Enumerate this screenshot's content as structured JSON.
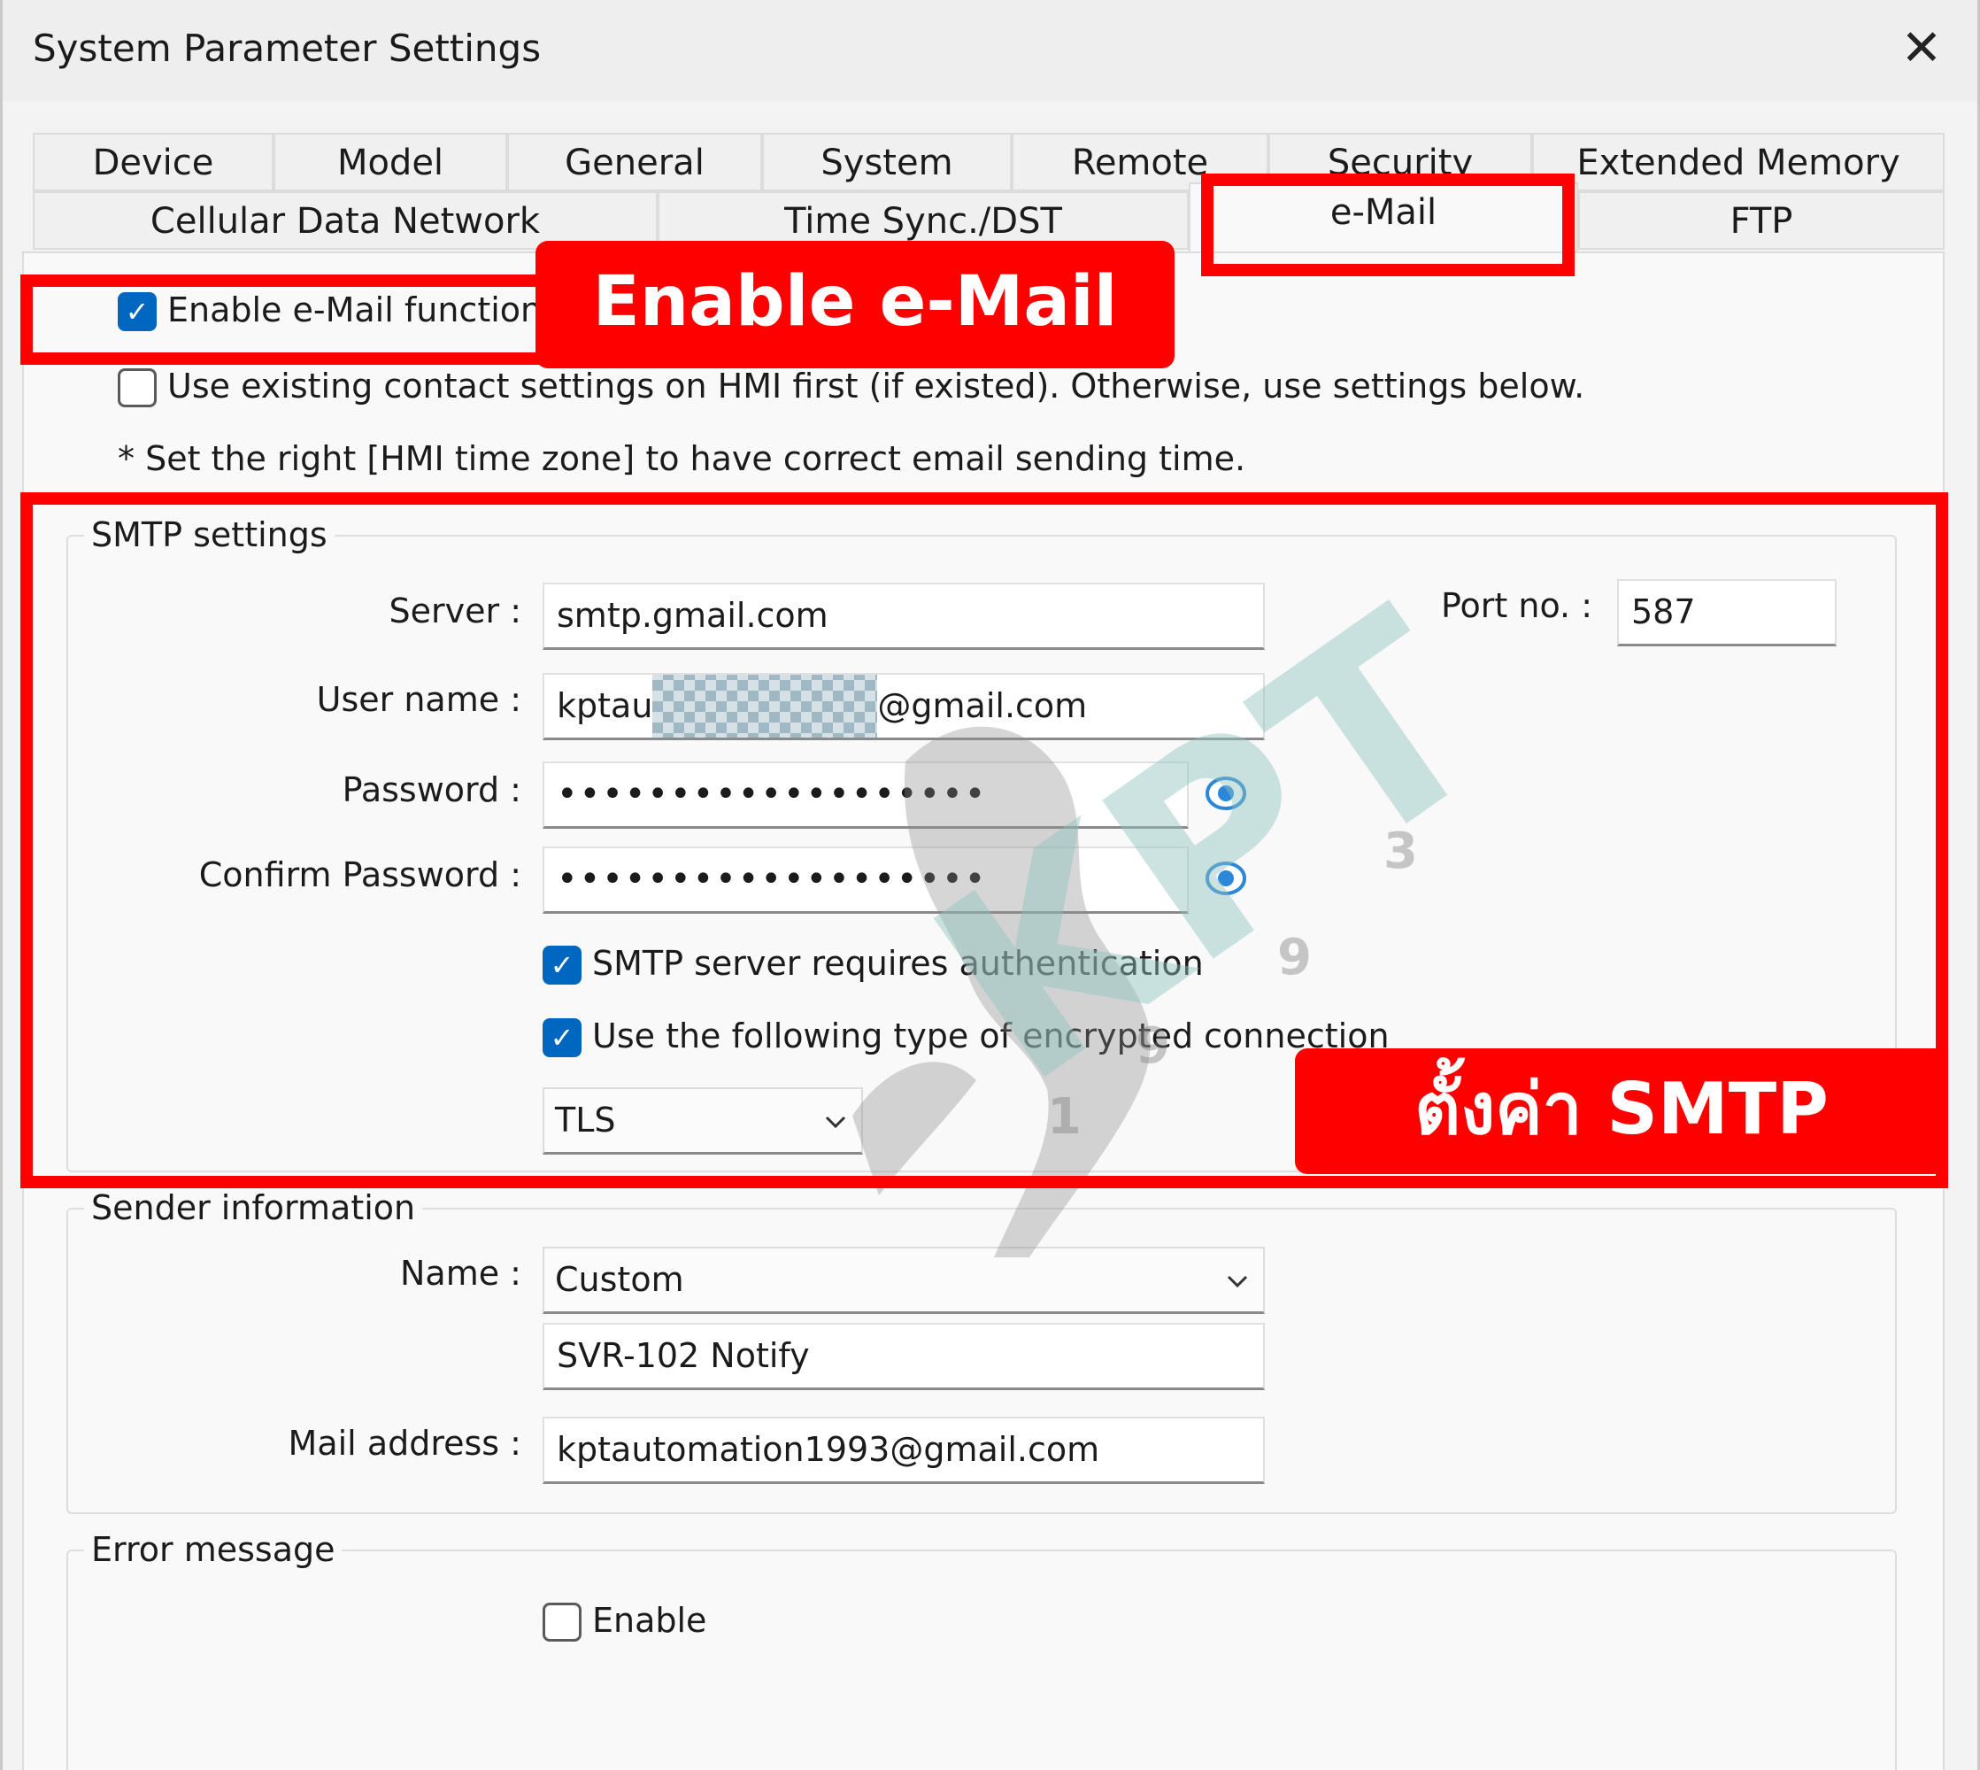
{
  "window": {
    "title": "System Parameter Settings"
  },
  "tabs": {
    "row1": [
      "Device",
      "Model",
      "General",
      "System",
      "Remote",
      "Security",
      "Extended Memory"
    ],
    "row2": [
      "Cellular Data Network",
      "Time Sync./DST",
      "e-Mail",
      "FTP"
    ],
    "active": "e-Mail"
  },
  "email": {
    "enable_label": "Enable e-Mail function",
    "enable_checked": true,
    "use_existing_label": "Use existing contact settings on HMI first (if existed). Otherwise, use settings below.",
    "use_existing_checked": false,
    "timezone_note": "* Set the right [HMI time zone] to have correct email sending time."
  },
  "smtp": {
    "group_label": "SMTP settings",
    "server_label": "Server :",
    "server_value": "smtp.gmail.com",
    "port_label": "Port no. :",
    "port_value": "587",
    "username_label": "User name :",
    "username_prefix": "kptau",
    "username_suffix": "@gmail.com",
    "password_label": "Password :",
    "password_value": "•••••••••••••••••••",
    "confirm_label": "Confirm Password :",
    "confirm_value": "•••••••••••••••••••",
    "auth_label": "SMTP server requires authentication",
    "auth_checked": true,
    "encrypt_label": "Use the following type of encrypted connection",
    "encrypt_checked": true,
    "encryption_type": "TLS"
  },
  "sender": {
    "group_label": "Sender information",
    "name_label": "Name :",
    "name_option": "Custom",
    "name_value": "SVR-102 Notify",
    "mail_label": "Mail address :",
    "mail_value": "kptautomation1993@gmail.com"
  },
  "error": {
    "group_label": "Error message",
    "enable_label": "Enable",
    "enable_checked": false
  },
  "annotations": {
    "enable_email_banner": "Enable e-Mail",
    "smtp_banner": "ตั้งค่า SMTP",
    "color": "#ff0000"
  },
  "watermark": {
    "text": "KPT",
    "digits": [
      "1",
      "9",
      "9",
      "3"
    ],
    "color": "#8fc3bf"
  }
}
